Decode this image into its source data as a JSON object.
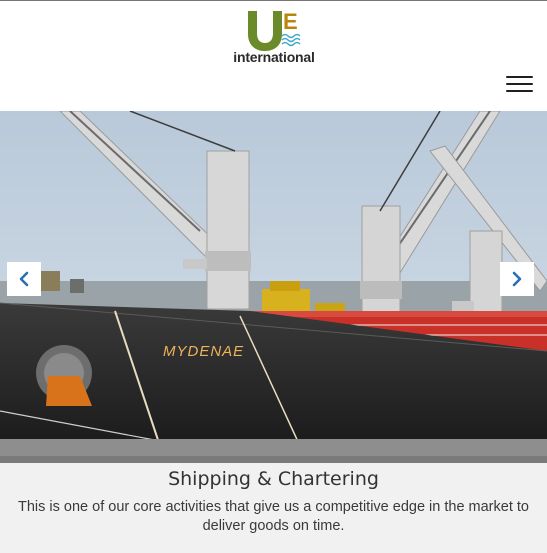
{
  "header": {
    "logo": {
      "mark": "UE",
      "text": "international"
    },
    "menu_icon": "hamburger-menu-icon"
  },
  "slider": {
    "image": "cargo-ship-with-cranes",
    "ship_name": "MYDENAE",
    "prev_icon": "chevron-left-icon",
    "next_icon": "chevron-right-icon",
    "caption": {
      "title": "Shipping & Chartering",
      "text": "This is one of our core activities that give us a competitive edge in the market to deliver goods on time."
    }
  },
  "colors": {
    "logo_green": "#6b8a2a",
    "logo_blue": "#3ea8c8",
    "arrow_blue": "#2a6fb0",
    "caption_bg": "#f1f1f1"
  }
}
